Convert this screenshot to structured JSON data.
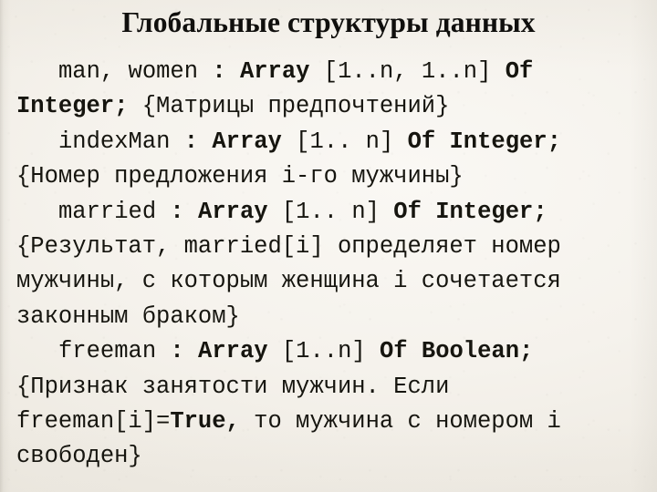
{
  "slide": {
    "title": "Глобальные структуры данных",
    "background_color": "#f3f0ea",
    "text_color": "#16150f"
  },
  "declarations": [
    {
      "id": "man-women",
      "name": "man, women",
      "separator": " : ",
      "type_keyword": "Array",
      "range": " [1..n, 1..n] ",
      "of_keyword": "Of Integer;",
      "comment": " {Матрицы предпочтений}"
    },
    {
      "id": "indexman",
      "name": "indexMan",
      "separator": " : ",
      "type_keyword": "Array",
      "range": " [1.. n] ",
      "of_keyword": "Of Integer;",
      "comment": " {Номер предложения i-го мужчины}"
    },
    {
      "id": "married",
      "name": "married",
      "separator": " : ",
      "type_keyword": "Array",
      "range": " [1.. n] ",
      "of_keyword": "Of Integer;",
      "comment": " {Результат, married[i] определяет номер мужчины, с которым женщина i сочетается законным браком}"
    },
    {
      "id": "freeman",
      "name": "freeman",
      "separator": " : ",
      "type_keyword": "Array",
      "range": " [1..n] ",
      "of_keyword": "Of Boolean;",
      "comment_before_bold": " {Признак занятости мужчин. Если freeman[i]=",
      "comment_bold": "True,",
      "comment_after_bold": " то мужчина с номером i свободен}"
    }
  ]
}
